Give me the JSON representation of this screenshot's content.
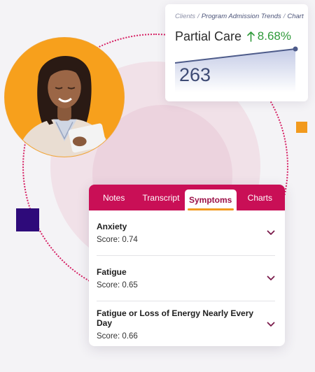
{
  "stat_card": {
    "breadcrumb": {
      "root": "Clients",
      "middle": "Program Admission Trends",
      "leaf": "Chart",
      "separator": "/"
    },
    "label": "Partial Care",
    "change": "8.68%",
    "value": "263"
  },
  "symptoms_card": {
    "tabs": [
      {
        "label": "Notes",
        "active": false
      },
      {
        "label": "Transcript",
        "active": false
      },
      {
        "label": "Symptoms",
        "active": true
      },
      {
        "label": "Charts",
        "active": false
      }
    ],
    "items": [
      {
        "name": "Anxiety",
        "score": "Score: 0.74"
      },
      {
        "name": "Fatigue",
        "score": "Score: 0.65"
      },
      {
        "name": "Fatigue or Loss of Energy Nearly Every Day",
        "score": "Score: 0.66"
      }
    ]
  },
  "colors": {
    "accent": "#c90f56",
    "positive": "#2f9a3a",
    "orange": "#f29a1e",
    "purple": "#2e0a7a"
  }
}
